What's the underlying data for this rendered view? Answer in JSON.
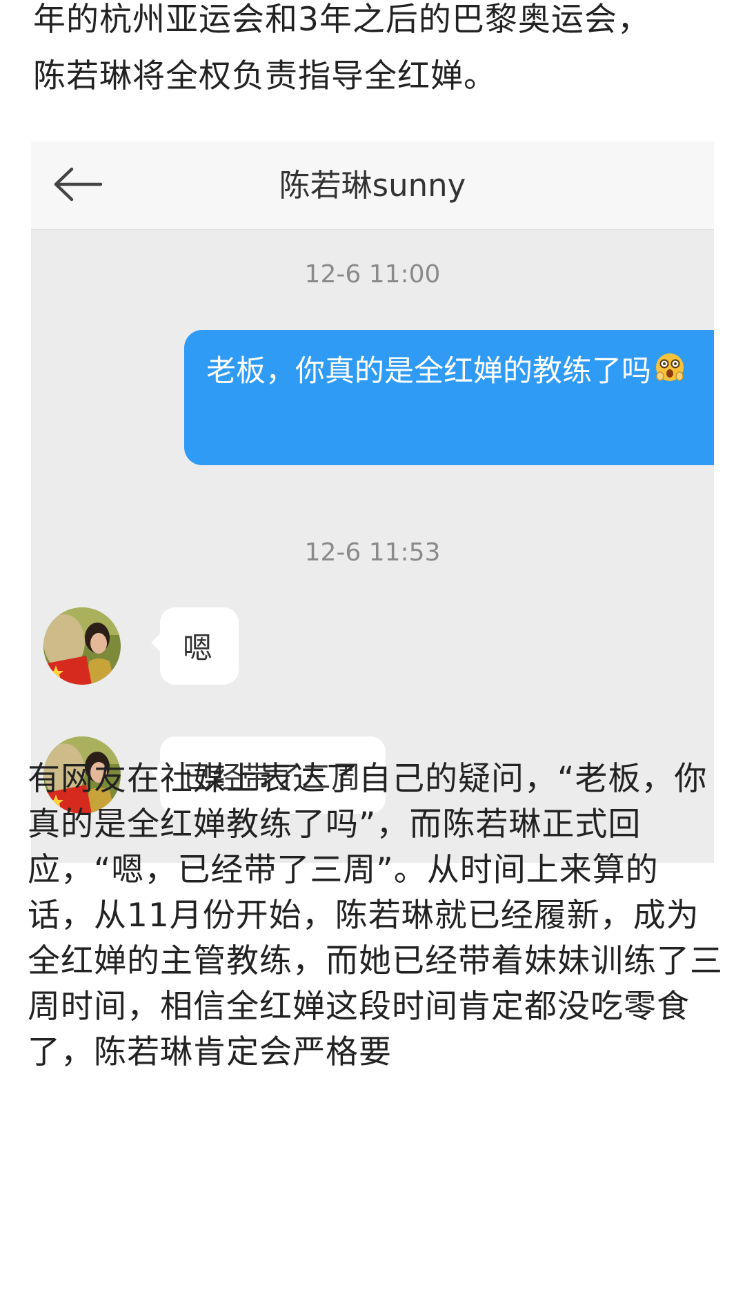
{
  "article": {
    "top_line_1": "年的杭州亚运会和3年之后的巴黎奥运会，",
    "top_line_2": "陈若琳将全权负责指导全红婵。",
    "bottom_paragraph": "有网友在社媒上表达了自己的疑问，“老板，你真的是全红婵教练了吗”，而陈若琳正式回应，“嗯，已经带了三周”。从时间上来算的话，从11月份开始，陈若琳就已经履新，成为全红婵的主管教练，而她已经带着妹妹训练了三周时间，相信全红婵这段时间肯定都没吃零食了，陈若琳肯定会严格要"
  },
  "chat": {
    "back_icon": "arrow-left-icon",
    "title": "陈若琳sunny",
    "messages": [
      {
        "timestamp": "12-6 11:00",
        "sender": "self",
        "text": "老板，你真的是全红婵的教练了吗",
        "emoji": "shocked-face-emoji"
      },
      {
        "timestamp": "12-6 11:53",
        "sender": "contact",
        "text": "嗯"
      },
      {
        "sender": "contact",
        "text": "已经带了三周"
      }
    ],
    "colors": {
      "outgoing_bubble": "#2f9bf5",
      "incoming_bubble": "#ffffff",
      "background": "#ececec"
    }
  }
}
